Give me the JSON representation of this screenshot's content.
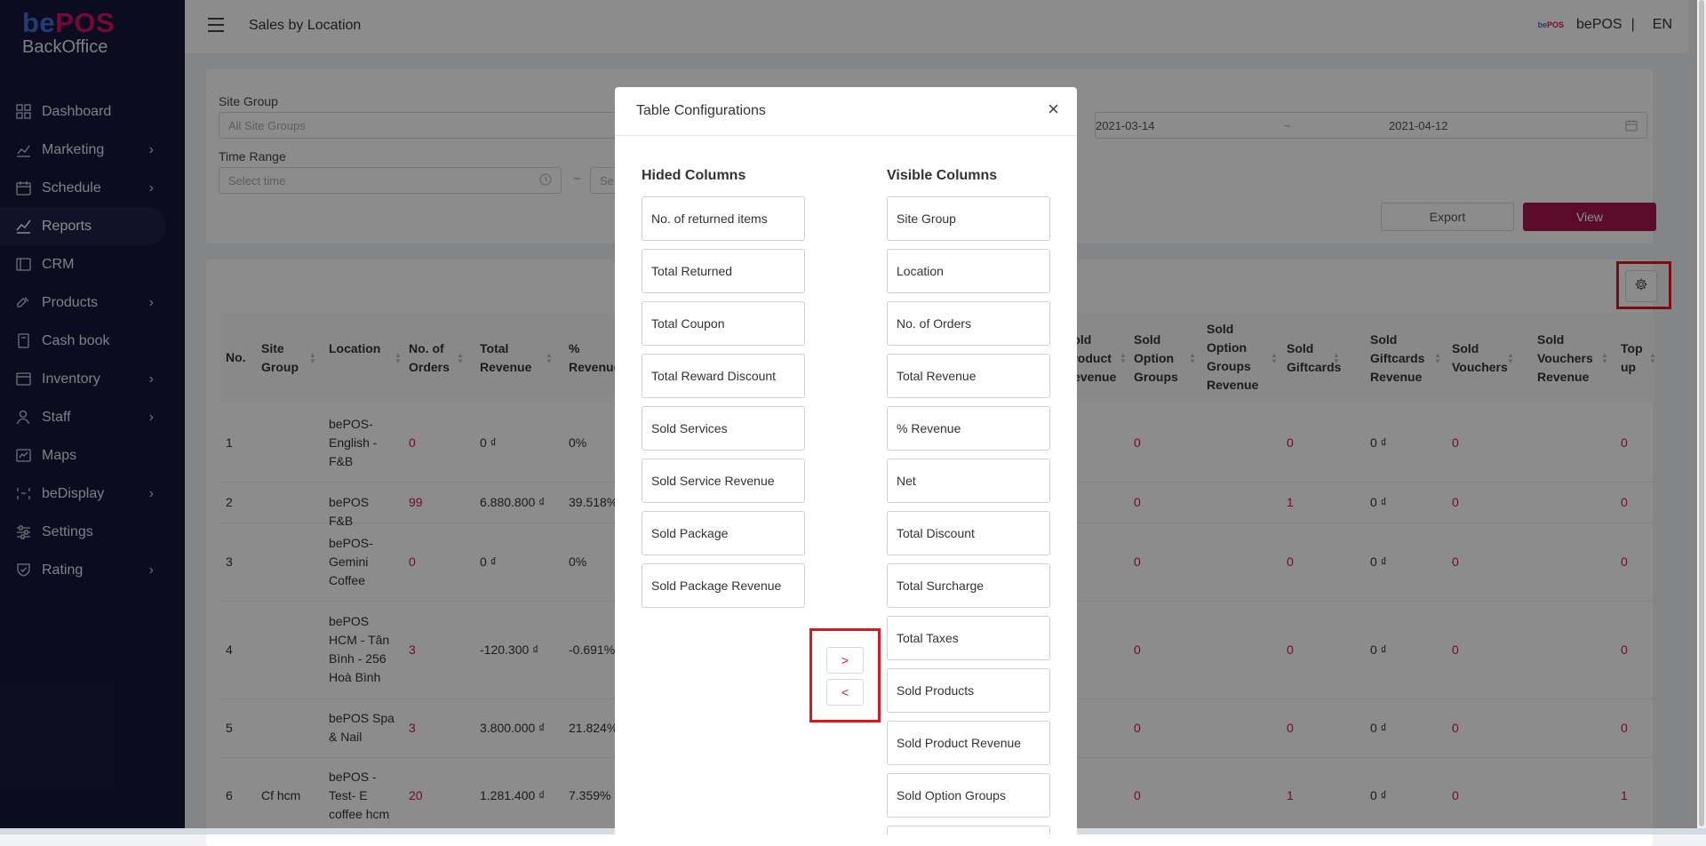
{
  "brand": {
    "logo_be": "be",
    "logo_pos": "POS",
    "logo_sub": "BackOffice",
    "mini_logo_be": "be",
    "mini_logo_pos": "POS"
  },
  "sidebar": {
    "items": [
      {
        "label": "Dashboard",
        "icon": "dashboard-icon",
        "chevron": false
      },
      {
        "label": "Marketing",
        "icon": "chart-icon",
        "chevron": true
      },
      {
        "label": "Schedule",
        "icon": "calendar-icon",
        "chevron": true
      },
      {
        "label": "Reports",
        "icon": "line-chart-icon",
        "chevron": false,
        "active": true
      },
      {
        "label": "CRM",
        "icon": "crm-icon",
        "chevron": false
      },
      {
        "label": "Products",
        "icon": "products-icon",
        "chevron": true
      },
      {
        "label": "Cash book",
        "icon": "book-icon",
        "chevron": false
      },
      {
        "label": "Inventory",
        "icon": "inventory-icon",
        "chevron": true
      },
      {
        "label": "Staff",
        "icon": "staff-icon",
        "chevron": true
      },
      {
        "label": "Maps",
        "icon": "map-icon",
        "chevron": false
      },
      {
        "label": "beDisplay",
        "icon": "display-icon",
        "chevron": true
      },
      {
        "label": "Settings",
        "icon": "settings-icon",
        "chevron": false
      },
      {
        "label": "Rating",
        "icon": "rating-icon",
        "chevron": true
      }
    ]
  },
  "header": {
    "title": "Sales by Location",
    "user": "bePOS",
    "separator": "|",
    "language": "EN"
  },
  "filters": {
    "site_group_label": "Site Group",
    "site_group_placeholder": "All Site Groups",
    "time_range_label": "Time Range",
    "time_start_placeholder": "Select time",
    "time_tilde": "~",
    "time_end_placeholder": "Se",
    "date_from": "2021-03-14",
    "date_to": "2021-04-12",
    "date_tilde": "~",
    "export_label": "Export",
    "view_label": "View"
  },
  "table": {
    "headers_left": [
      "No.",
      "Site Group",
      "Location",
      "No. of Orders",
      "Total Revenue",
      "% Revenue"
    ],
    "headers_right": [
      "Sold Product Revenue",
      "Sold Option Groups",
      "Sold Option Groups Revenue",
      "Sold Giftcards",
      "Sold Giftcards Revenue",
      "Sold Vouchers",
      "Sold Vouchers Revenue",
      "Top up"
    ],
    "rows": [
      {
        "no": "1",
        "site_group": "",
        "location": "bePOS- English - F&B",
        "orders": "0",
        "revenue": "0 ₫",
        "pct": "0%",
        "option_groups": "0",
        "giftcards": "0",
        "giftcards_rev": "0 ₫",
        "vouchers": "0",
        "topup": "0"
      },
      {
        "no": "2",
        "site_group": "",
        "location": "bePOS F&B",
        "orders": "99",
        "revenue": "6.880.800 ₫",
        "pct": "39.518%",
        "option_groups": "0",
        "giftcards": "1",
        "giftcards_rev": "0 ₫",
        "vouchers": "0",
        "topup": "0"
      },
      {
        "no": "3",
        "site_group": "",
        "location": "bePOS- Gemini Coffee",
        "orders": "0",
        "revenue": "0 ₫",
        "pct": "0%",
        "option_groups": "0",
        "giftcards": "0",
        "giftcards_rev": "0 ₫",
        "vouchers": "0",
        "topup": "0"
      },
      {
        "no": "4",
        "site_group": "",
        "location": "bePOS HCM - Tân Bình - 256 Hoà Bình",
        "orders": "3",
        "revenue": "-120.300 ₫",
        "pct": "-0.691%",
        "option_groups": "0",
        "giftcards": "0",
        "giftcards_rev": "0 ₫",
        "vouchers": "0",
        "topup": "0"
      },
      {
        "no": "5",
        "site_group": "",
        "location": "bePOS Spa & Nail",
        "orders": "3",
        "revenue": "3.800.000 ₫",
        "pct": "21.824%",
        "option_groups": "0",
        "giftcards": "0",
        "giftcards_rev": "0 ₫",
        "vouchers": "0",
        "topup": "0"
      },
      {
        "no": "6",
        "site_group": "Cf hcm",
        "location": "bePOS - Test- E coffee hcm",
        "orders": "20",
        "revenue": "1.281.400 ₫",
        "pct": "7.359%",
        "option_groups": "0",
        "giftcards": "1",
        "giftcards_rev": "0 ₫",
        "vouchers": "0",
        "topup": "1"
      }
    ]
  },
  "modal": {
    "title": "Table Configurations",
    "close": "×",
    "hidden_title": "Hided Columns",
    "visible_title": "Visible Columns",
    "hidden_columns": [
      "No. of returned items",
      "Total Returned",
      "Total Coupon",
      "Total Reward Discount",
      "Sold Services",
      "Sold Service Revenue",
      "Sold Package",
      "Sold Package Revenue"
    ],
    "visible_columns": [
      "Site Group",
      "Location",
      "No. of Orders",
      "Total Revenue",
      "% Revenue",
      "Net",
      "Total Discount",
      "Total Surcharge",
      "Total Taxes",
      "Sold Products",
      "Sold Product Revenue",
      "Sold Option Groups",
      ""
    ],
    "move_right": ">",
    "move_left": "<"
  },
  "colors": {
    "sidebar_bg": "#15173a",
    "accent": "#d6115f",
    "view_btn": "#a8174f",
    "highlight": "#e0151d"
  }
}
